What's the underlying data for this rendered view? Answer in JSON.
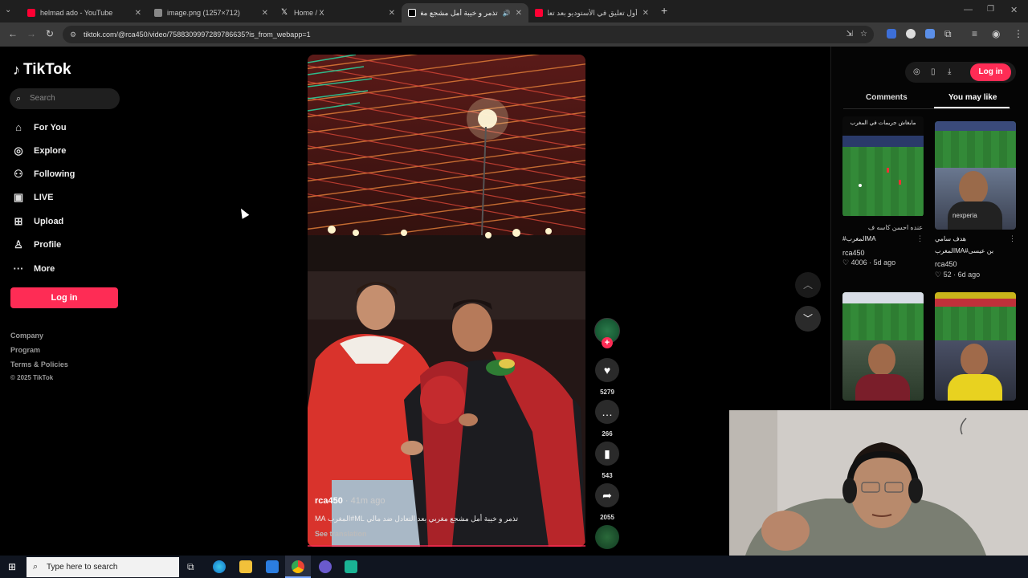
{
  "browser": {
    "tabs": [
      {
        "title": "helmad ado - YouTube",
        "fav_color": "#ff0033",
        "active": false
      },
      {
        "title": "image.png (1257×712)",
        "fav_color": "#888888",
        "active": false
      },
      {
        "title": "Home / X",
        "fav_color": "#ffffff",
        "active": false
      },
      {
        "title": "تذمر و خيبة أمل مشجع مغربي",
        "fav_color": "#ffffff",
        "active": true
      },
      {
        "title": "أول تعليق في الأستوديو بعد تعا",
        "fav_color": "#ff0033",
        "active": false
      }
    ],
    "new_tab": "+",
    "url": "tiktok.com/@rca450/video/7588309997289786635?is_from_webapp=1"
  },
  "sidebar": {
    "logo": "TikTok",
    "search_placeholder": "Search",
    "nav": [
      {
        "label": "For You",
        "icon": "home-icon"
      },
      {
        "label": "Explore",
        "icon": "compass-icon"
      },
      {
        "label": "Following",
        "icon": "following-icon"
      },
      {
        "label": "LIVE",
        "icon": "live-icon"
      },
      {
        "label": "Upload",
        "icon": "upload-icon"
      },
      {
        "label": "Profile",
        "icon": "profile-icon"
      },
      {
        "label": "More",
        "icon": "more-icon"
      }
    ],
    "login": "Log in",
    "footer": [
      "Company",
      "Program",
      "Terms & Policies",
      "© 2025 TikTok"
    ]
  },
  "video": {
    "author": "rca450",
    "time": " · 41m ago",
    "caption": "تذمر و خيبة أمل مشجع مغربي بعد التعادل ضد مالي ML#المغرب MA",
    "see_translation": "See translation"
  },
  "actions": {
    "likes": "5279",
    "comments": "266",
    "saves": "543",
    "shares": "2055"
  },
  "right_panel": {
    "login": "Log in",
    "tabs": [
      "Comments",
      "You may like"
    ],
    "active_tab": "You may like",
    "cards": [
      {
        "overlay": "مابغاش جريمات في المغرب",
        "caption": "عنده احسن كاسه ف",
        "title": "#المغربMA",
        "author": "rca450",
        "likes": "4006",
        "age": "5d ago"
      },
      {
        "overlay": "",
        "caption": "nexperia",
        "title": "هدف سامي",
        "title2": "بن عيسى#MAالمغرب",
        "author": "rca450",
        "likes": "52",
        "age": "6d ago"
      }
    ]
  },
  "taskbar": {
    "search_placeholder": "Type here to search"
  },
  "colors": {
    "accent": "#fe2c55",
    "background": "#000000"
  }
}
